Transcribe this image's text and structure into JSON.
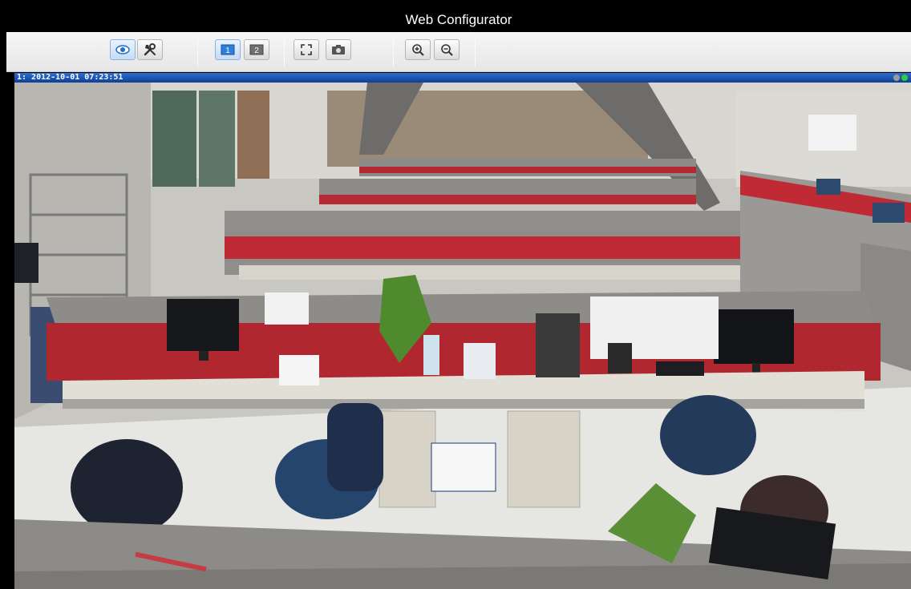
{
  "window": {
    "title": "Web Configurator"
  },
  "toolbar": {
    "buttons": [
      {
        "name": "view-button",
        "icon": "eye-icon",
        "active": true
      },
      {
        "name": "settings-button",
        "icon": "tools-icon",
        "active": false
      },
      {
        "name": "layout-1-button",
        "icon": "layout-1-icon",
        "label": "1",
        "active": true
      },
      {
        "name": "layout-2-button",
        "icon": "layout-2-icon",
        "label": "2",
        "active": false
      },
      {
        "name": "fullscreen-button",
        "icon": "fullscreen-icon",
        "active": false
      },
      {
        "name": "snapshot-button",
        "icon": "camera-icon",
        "active": false
      },
      {
        "name": "zoom-in-button",
        "icon": "zoom-in-icon",
        "active": false
      },
      {
        "name": "zoom-out-button",
        "icon": "zoom-out-icon",
        "active": false
      }
    ]
  },
  "video": {
    "overlay_text": "1:  2012-10-01 07:23:51",
    "status_colors": [
      "#9a9a9a",
      "#2ecc40"
    ],
    "accent": "#1a56b8"
  }
}
